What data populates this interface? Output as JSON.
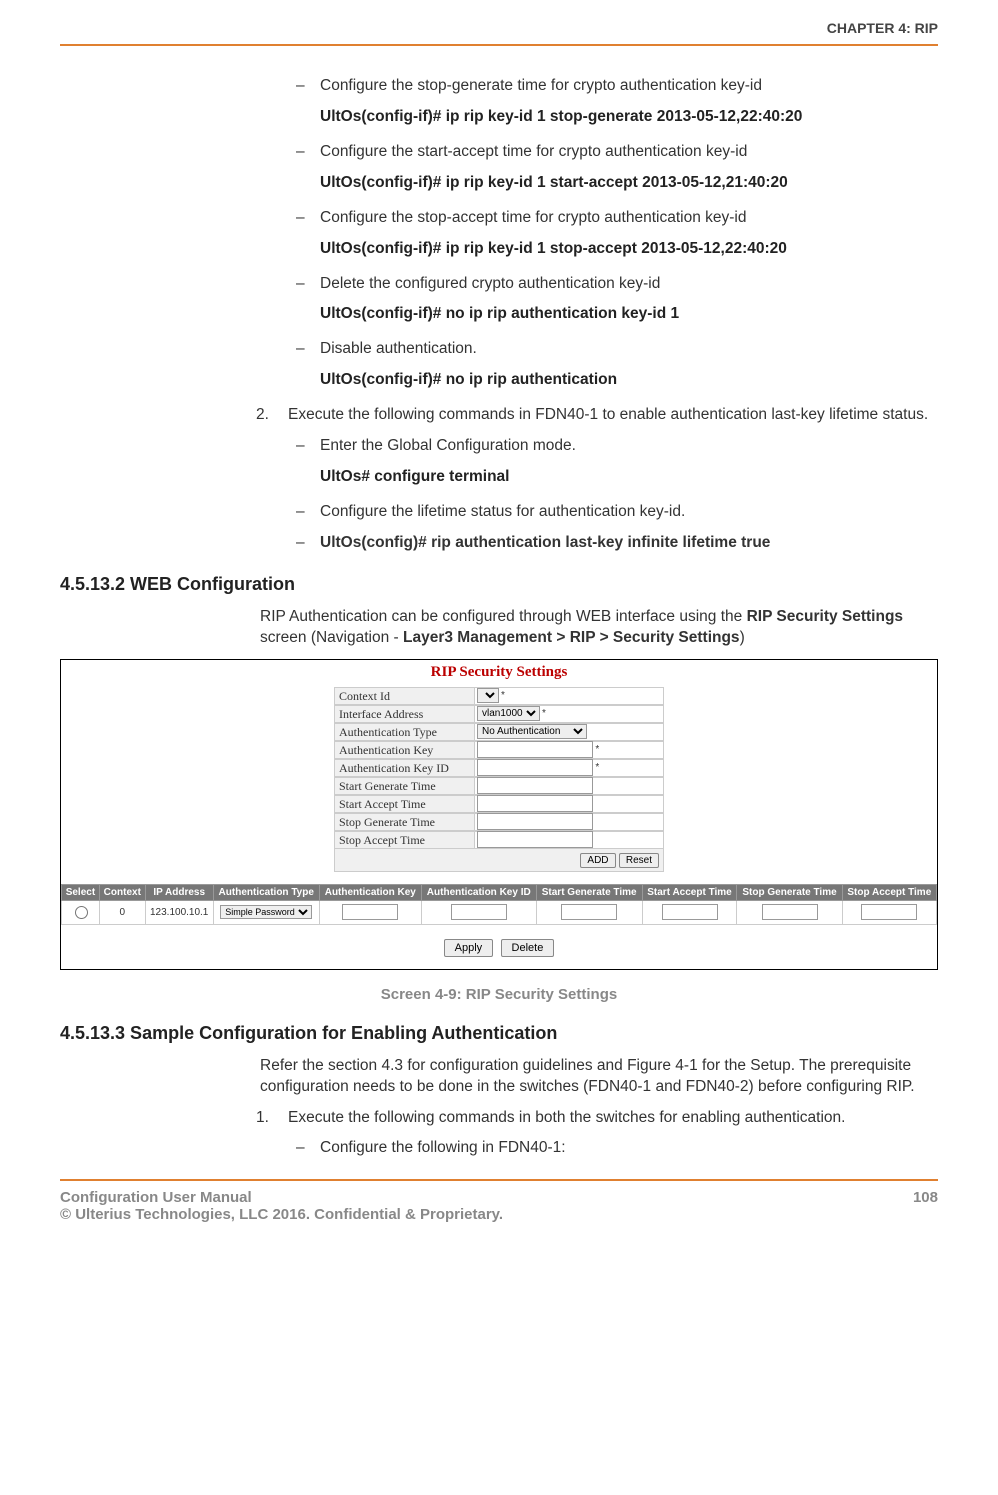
{
  "header": {
    "chapter": "CHAPTER 4: RIP"
  },
  "items": {
    "b1": "Configure the stop-generate time for crypto authentication key-id",
    "c1": "UltOs(config-if)# ip rip key-id 1 stop-generate 2013-05-12,22:40:20",
    "b2": "Configure the start-accept time for crypto authentication key-id",
    "c2": "UltOs(config-if)# ip rip key-id 1 start-accept 2013-05-12,21:40:20",
    "b3": "Configure the stop-accept time for crypto authentication key-id",
    "c3": "UltOs(config-if)# ip rip key-id 1 stop-accept 2013-05-12,22:40:20",
    "b4": "Delete the configured crypto authentication key-id",
    "c4": "UltOs(config-if)# no ip rip authentication key-id 1",
    "b5": "Disable authentication.",
    "c5": "UltOs(config-if)# no ip rip authentication",
    "n2": "Execute the following commands in FDN40-1 to enable authentication last-key lifetime status.",
    "b6": "Enter the Global Configuration mode.",
    "c6": "UltOs# configure terminal",
    "b7": "Configure the lifetime status for authentication key-id.",
    "b8": "UltOs(config)# rip authentication last-key infinite lifetime true"
  },
  "sec_web": {
    "heading": "4.5.13.2   WEB Configuration",
    "para_pre": "RIP Authentication can be configured through WEB interface using the ",
    "b1": "RIP Security Settings",
    "mid": " screen (Navigation - ",
    "b2": "Layer3 Management > RIP > Security Settings",
    "end": ")"
  },
  "shot": {
    "title": "RIP Security Settings",
    "labels": {
      "ctx": "Context Id",
      "ifaddr": "Interface Address",
      "atype": "Authentication Type",
      "akey": "Authentication Key",
      "akid": "Authentication Key ID",
      "sgen": "Start Generate Time",
      "sacc": "Start Accept Time",
      "stgen": "Stop Generate Time",
      "stacc": "Stop Accept Time"
    },
    "opts": {
      "if": "vlan1000",
      "auth": "No Authentication"
    },
    "btn_add": "ADD",
    "btn_reset": "Reset",
    "btn_apply": "Apply",
    "btn_delete": "Delete",
    "cols": {
      "sel": "Select",
      "ctx": "Context",
      "ip": "IP Address",
      "atype": "Authentication Type",
      "akey": "Authentication Key",
      "akid": "Authentication Key ID",
      "sgen": "Start Generate Time",
      "sacc": "Start Accept Time",
      "stgen": "Stop Generate Time",
      "stacc": "Stop Accept Time"
    },
    "row": {
      "ctx": "0",
      "ip": "123.100.10.1",
      "atype": "Simple Password"
    }
  },
  "caption": "Screen 4-9: RIP Security Settings",
  "sec_sample": {
    "heading": "4.5.13.3   Sample Configuration for Enabling Authentication",
    "p1": "Refer the section 4.3 for configuration guidelines and Figure 4-1 for the Setup. The prerequisite configuration needs to be done in the switches (FDN40-1 and FDN40-2) before configuring RIP.",
    "n1": "Execute the following commands in both the switches for enabling authentication.",
    "b1": "Configure the following in FDN40-1:"
  },
  "footer": {
    "left1": "Configuration User Manual",
    "left2": "© Ulterius Technologies, LLC 2016. Confidential & Proprietary.",
    "page": "108"
  }
}
